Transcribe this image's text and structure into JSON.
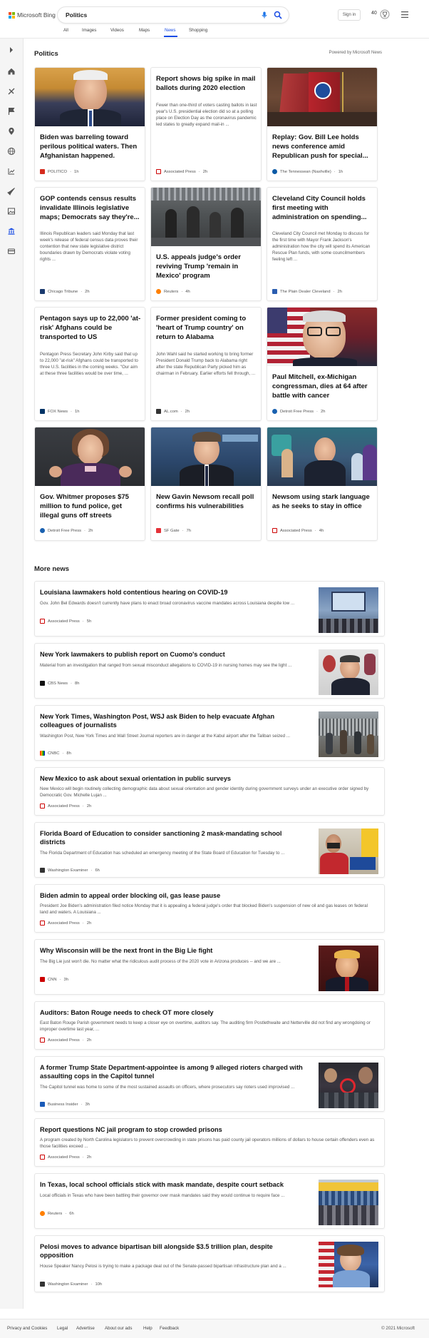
{
  "header": {
    "logo_text": "Microsoft Bing",
    "search_value": "Politics",
    "signin_label": "Sign in",
    "points": "40",
    "tabs": [
      "All",
      "Images",
      "Videos",
      "Maps",
      "News",
      "Shopping"
    ],
    "active_tab": "News"
  },
  "main": {
    "section_title": "Politics",
    "powered_by": "Powered by Microsoft News",
    "cards": [
      {
        "title": "Biden was barreling toward perilous political waters. Then Afghanistan happened.",
        "desc": "",
        "source": "POLITICO",
        "time": "1h",
        "has_image": true
      },
      {
        "title": "Report shows big spike in mail ballots during 2020 election",
        "desc": "Fewer than one-third of voters casting ballots in last year's U.S. presidential election did so at a polling place on Election Day as the coronavirus pandemic led states to greatly expand mail-in ...",
        "source": "Associated Press",
        "time": "2h",
        "has_image": false
      },
      {
        "title": "Replay: Gov. Bill Lee holds news conference amid Republican push for special...",
        "desc": "",
        "source": "The Tennessean (Nashville)",
        "time": "1h",
        "has_image": true
      },
      {
        "title": "GOP contends census results invalidate Illinois legislative maps; Democrats say they're...",
        "desc": "Illinois Republican leaders said Monday that last week's release of federal census data proves their contention that new state legislative district boundaries drawn by Democrats violate voting rights ...",
        "source": "Chicago Tribune",
        "time": "2h",
        "has_image": false
      },
      {
        "title": "U.S. appeals judge's order reviving Trump 'remain in Mexico' program",
        "desc": "",
        "source": "Reuters",
        "time": "4h",
        "has_image": true
      },
      {
        "title": "Cleveland City Council holds first meeting with administration on spending...",
        "desc": "Cleveland City Council met Monday to discuss for the first time with Mayor Frank Jackson's administration how the city will spend its American Rescue Plan funds, with some councilmembers feeling left ...",
        "source": "The Plain Dealer Cleveland",
        "time": "2h",
        "has_image": false
      },
      {
        "title": "Pentagon says up to 22,000 'at-risk' Afghans could be transported to US",
        "desc": "Pentagon Press Secretary John Kirby said that up to 22,000 \"at-risk\" Afghans could be transported to three U.S. facilities in the coming weeks. \"Our aim at these three facilities would be over time, ...",
        "source": "FOX News",
        "time": "1h",
        "has_image": false
      },
      {
        "title": "Former president coming to 'heart of Trump country' on return to Alabama",
        "desc": "John Wahl said he started working to bring former President Donald Trump back to Alabama right after the state Republican Party picked him as chairman in February. Earlier efforts fell through, ...",
        "source": "AL.com",
        "time": "2h",
        "has_image": false
      },
      {
        "title": "Paul Mitchell, ex-Michigan congressman, dies at 64 after battle with cancer",
        "desc": "",
        "source": "Detroit Free Press",
        "time": "2h",
        "has_image": true
      },
      {
        "title": "Gov. Whitmer proposes $75 million to fund police, get illegal guns off streets",
        "desc": "",
        "source": "Detroit Free Press",
        "time": "2h",
        "has_image": true
      },
      {
        "title": "New Gavin Newsom recall poll confirms his vulnerabilities",
        "desc": "",
        "source": "SF Gate",
        "time": "7h",
        "has_image": true
      },
      {
        "title": "Newsom using stark language as he seeks to stay in office",
        "desc": "",
        "source": "Associated Press",
        "time": "4h",
        "has_image": true
      }
    ],
    "more_title": "More news",
    "more": [
      {
        "title": "Louisiana lawmakers hold contentious hearing on COVID-19",
        "desc": "Gov. John Bel Edwards doesn't currently have plans to enact broad coronavirus vaccine mandates across Louisiana despite low ...",
        "source": "Associated Press",
        "time": "5h",
        "has_image": true
      },
      {
        "title": "New York lawmakers to publish report on Cuomo's conduct",
        "desc": "Material from an investigation that ranged from sexual misconduct allegations to COVID-19 in nursing homes may see the light ...",
        "source": "CBS News",
        "time": "8h",
        "has_image": true
      },
      {
        "title": "New York Times, Washington Post, WSJ ask Biden to help evacuate Afghan colleagues of journalists",
        "desc": "Washington Post, New York Times and Wall Street Journal reporters are in danger at the Kabul airport after the Taliban seized ...",
        "source": "CNBC",
        "time": "8h",
        "has_image": true
      },
      {
        "title": "New Mexico to ask about sexual orientation in public surveys",
        "desc": "New Mexico will begin routinely collecting demographic data about sexual orientation and gender identity during government surveys under an executive order signed by Democratic Gov. Michelle Lujan ...",
        "source": "Associated Press",
        "time": "2h",
        "has_image": false
      },
      {
        "title": "Florida Board of Education to consider sanctioning 2 mask-mandating school districts",
        "desc": "The Florida Department of Education has scheduled an emergency meeting of the State Board of Education for Tuesday to ...",
        "source": "Washington Examiner",
        "time": "6h",
        "has_image": true
      },
      {
        "title": "Biden admin to appeal order blocking oil, gas lease pause",
        "desc": "President Joe Biden's administration filed notice Monday that it is appealing a federal judge's order that blocked Biden's suspension of new oil and gas leases on federal land and waters. A Louisiana ...",
        "source": "Associated Press",
        "time": "2h",
        "has_image": false
      },
      {
        "title": "Why Wisconsin will be the next front in the Big Lie fight",
        "desc": "The Big Lie just won't die. No matter what the ridiculous audit process of the 2020 vote in Arizona produces -- and we are ...",
        "source": "CNN",
        "time": "3h",
        "has_image": true
      },
      {
        "title": "Auditors: Baton Rouge needs to check OT more closely",
        "desc": "East Baton Rouge Parish government needs to keep a closer eye on overtime, auditors say. The auditing firm Postlethwaite and Netterville did not find any wrongdoing or improper overtime last year, ...",
        "source": "Associated Press",
        "time": "2h",
        "has_image": false
      },
      {
        "title": "A former Trump State Department-appointee is among 9 alleged rioters charged with assaulting cops in the Capitol tunnel",
        "desc": "The Capitol tunnel was home to some of the most sustained assaults on officers, where prosecutors say rioters used improvised ...",
        "source": "Business Insider",
        "time": "3h",
        "has_image": true
      },
      {
        "title": "Report questions NC jail program to stop crowded prisons",
        "desc": "A program created by North Carolina legislators to prevent overcrowding in state prisons has paid county jail operators millions of dollars to house certain offenders even as those facilities exceed ...",
        "source": "Associated Press",
        "time": "2h",
        "has_image": false
      },
      {
        "title": "In Texas, local school officials stick with mask mandate, despite court setback",
        "desc": "Local officials in Texas who have been battling their governor over mask mandates said they would continue to require face ...",
        "source": "Reuters",
        "time": "6h",
        "has_image": true
      },
      {
        "title": "Pelosi moves to advance bipartisan bill alongside $3.5 trillion plan, despite opposition",
        "desc": "House Speaker Nancy Pelosi is trying to make a package deal out of the Senate-passed bipartisan infrastructure plan and a ...",
        "source": "Washington Examiner",
        "time": "10h",
        "has_image": true
      }
    ]
  },
  "footer": {
    "links": [
      "Privacy and Cookies",
      "Legal",
      "Advertise",
      "About our ads",
      "Help",
      "Feedback"
    ],
    "copyright": "© 2021 Microsoft"
  },
  "colors": {
    "accent": "#174ae4",
    "rail_bg": "#f5f5f5"
  }
}
